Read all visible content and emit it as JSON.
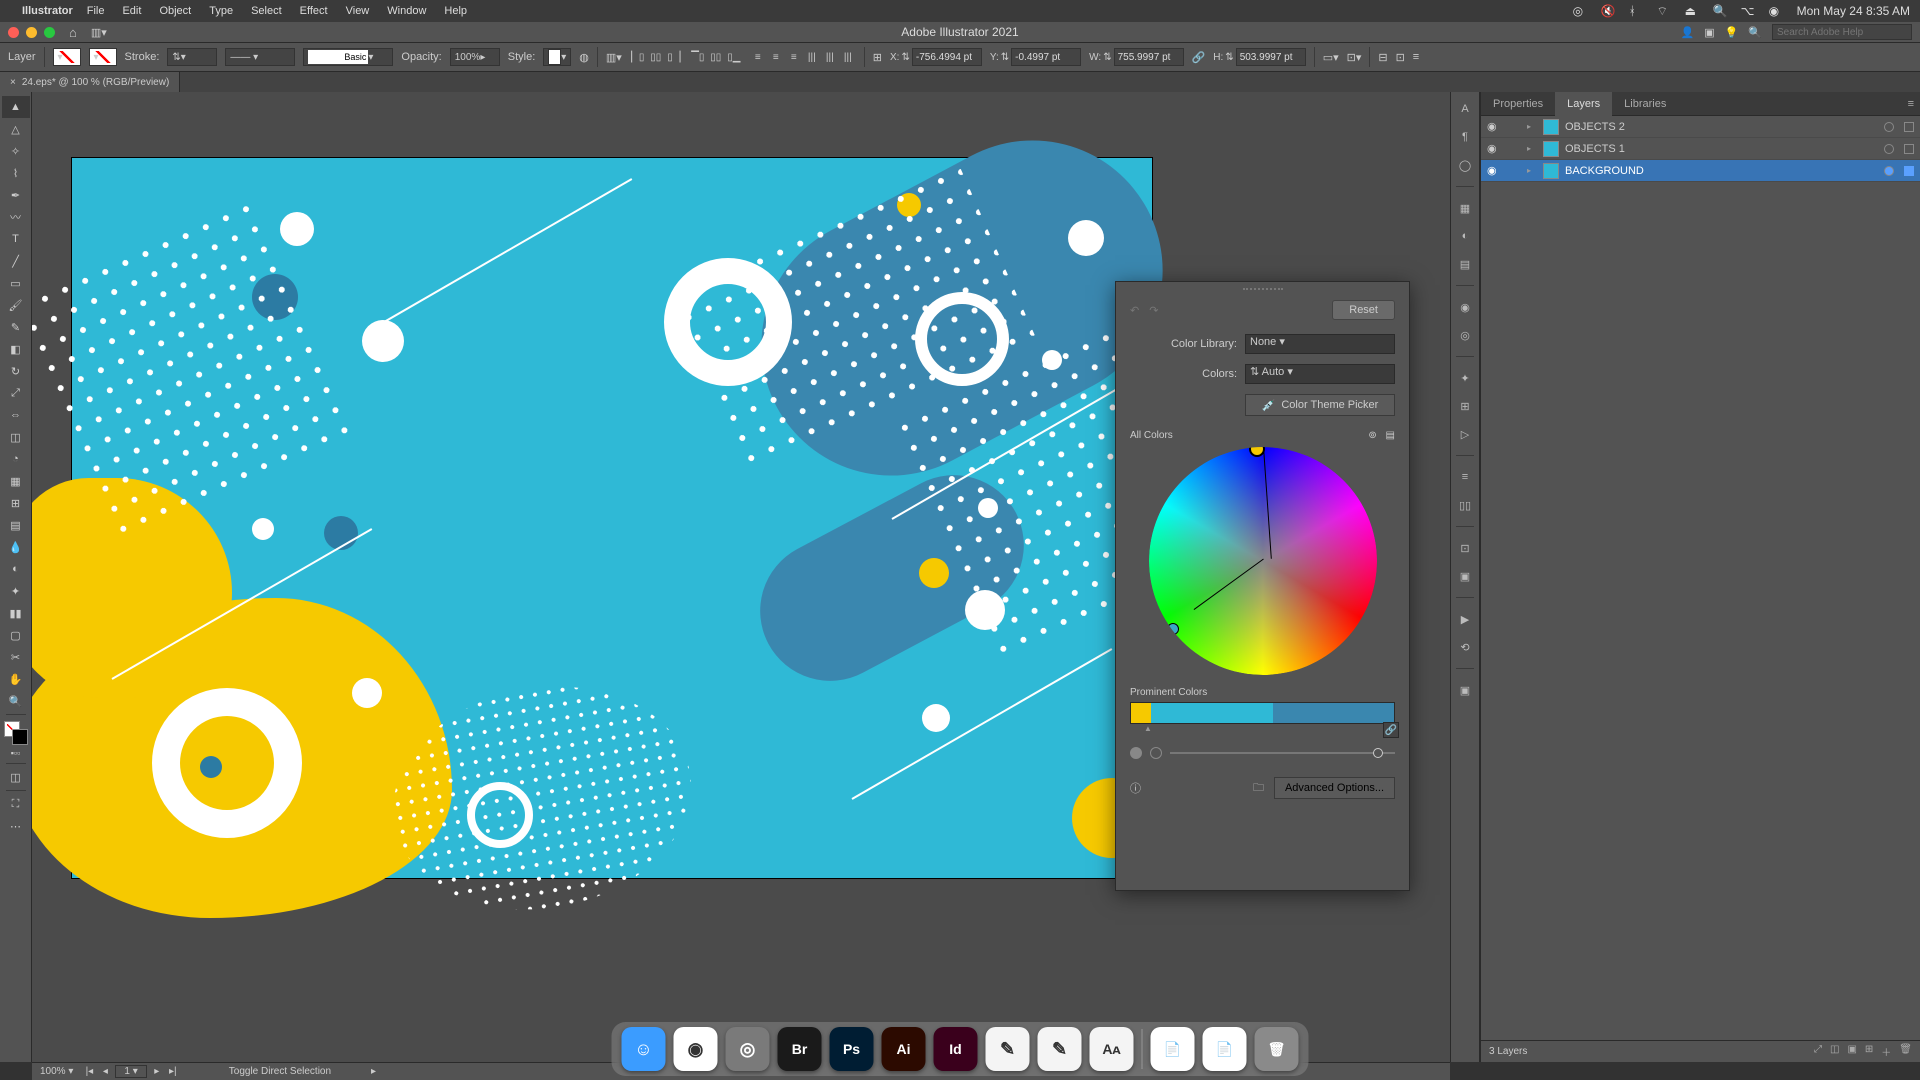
{
  "mac_menubar": {
    "app_name": "Illustrator",
    "menus": [
      "File",
      "Edit",
      "Object",
      "Type",
      "Select",
      "Effect",
      "View",
      "Window",
      "Help"
    ],
    "clock": "Mon May 24  8:35 AM"
  },
  "appbar": {
    "title": "Adobe Illustrator 2021",
    "search_placeholder": "Search Adobe Help"
  },
  "ctrlbar": {
    "target": "Layer",
    "stroke_label": "Stroke:",
    "stroke_weight": "",
    "brush_label": "Basic",
    "opacity_label": "Opacity:",
    "opacity_value": "100%",
    "style_label": "Style:",
    "x_label": "X:",
    "x_value": "-756.4994 pt",
    "y_label": "Y:",
    "y_value": "-0.4997 pt",
    "w_label": "W:",
    "w_value": "755.9997 pt",
    "h_label": "H:",
    "h_value": "503.9997 pt"
  },
  "doc_tab": {
    "label": "24.eps* @ 100 % (RGB/Preview)"
  },
  "recolor": {
    "reset": "Reset",
    "color_library_label": "Color Library:",
    "color_library_value": "None",
    "colors_label": "Colors:",
    "colors_value": "Auto",
    "theme_picker": "Color Theme Picker",
    "all_colors": "All Colors",
    "prominent_label": "Prominent Colors",
    "advanced": "Advanced Options...",
    "prominent_colors": [
      "#f6c900",
      "#2fb9d6",
      "#3a87af"
    ]
  },
  "panels": {
    "tabs": [
      "Properties",
      "Layers",
      "Libraries"
    ],
    "active_tab": "Layers",
    "layers": [
      {
        "name": "OBJECTS 2",
        "thumb": "#2fb9d6",
        "selected": false
      },
      {
        "name": "OBJECTS 1",
        "thumb": "#2fb9d6",
        "selected": false
      },
      {
        "name": "BACKGROUND",
        "thumb": "#2fb9d6",
        "selected": true
      }
    ],
    "footer": "3 Layers"
  },
  "statusbar": {
    "zoom": "100%",
    "page": "1",
    "hint": "Toggle Direct Selection"
  },
  "dock_apps": [
    {
      "name": "Finder",
      "bg": "#3b9cff",
      "txt": "☺"
    },
    {
      "name": "Chrome",
      "bg": "#fff",
      "txt": "◉"
    },
    {
      "name": "Safari",
      "bg": "#7a7a7a",
      "txt": "◎"
    },
    {
      "name": "Bridge",
      "bg": "#1a1a1a",
      "txt": "Br"
    },
    {
      "name": "Photoshop",
      "bg": "#001d33",
      "txt": "Ps"
    },
    {
      "name": "Illustrator",
      "bg": "#2c0a00",
      "txt": "Ai"
    },
    {
      "name": "InDesign",
      "bg": "#3a001c",
      "txt": "Id"
    },
    {
      "name": "TextEdit",
      "bg": "#f4f4f4",
      "txt": "✎"
    },
    {
      "name": "Notes",
      "bg": "#f4f4f4",
      "txt": "✎"
    },
    {
      "name": "FontBook",
      "bg": "#f4f4f4",
      "txt": "Aᴀ"
    },
    {
      "name": "DocA",
      "bg": "#fff",
      "txt": "📄"
    },
    {
      "name": "DocB",
      "bg": "#fff",
      "txt": "📄"
    },
    {
      "name": "Trash",
      "bg": "#8a8a8a",
      "txt": "🗑"
    }
  ]
}
